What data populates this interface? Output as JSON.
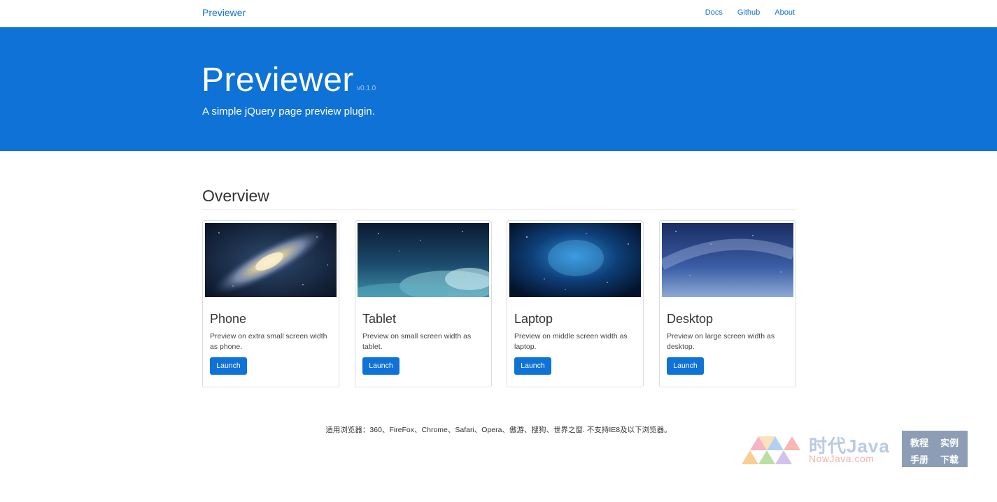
{
  "nav": {
    "brand": "Previewer",
    "links": [
      "Docs",
      "Github",
      "About"
    ]
  },
  "hero": {
    "title": "Previewer",
    "version": "v0.1.0",
    "subtitle": "A simple jQuery page preview plugin."
  },
  "overview": {
    "heading": "Overview",
    "cards": [
      {
        "title": "Phone",
        "desc": "Preview on extra small screen width as phone.",
        "button": "Launch",
        "image": "galaxy-image"
      },
      {
        "title": "Tablet",
        "desc": "Preview on small screen width as tablet.",
        "button": "Launch",
        "image": "night-clouds-image"
      },
      {
        "title": "Laptop",
        "desc": "Preview on middle screen width as laptop.",
        "button": "Launch",
        "image": "nebula-image"
      },
      {
        "title": "Desktop",
        "desc": "Preview on large screen width as desktop.",
        "button": "Launch",
        "image": "milky-way-image"
      }
    ]
  },
  "footer": {
    "text": "适用浏览器：360、FireFox、Chrome、Safari、Opera、傲游、搜狗、世界之窗. 不支持IE8及以下浏览器。"
  },
  "watermark": {
    "name": "时代Java",
    "url": "NowJava.com",
    "box": [
      "教程",
      "实例",
      "手册",
      "下载"
    ]
  },
  "colors": {
    "primary": "#0f72d7",
    "link": "#0f72d2"
  }
}
